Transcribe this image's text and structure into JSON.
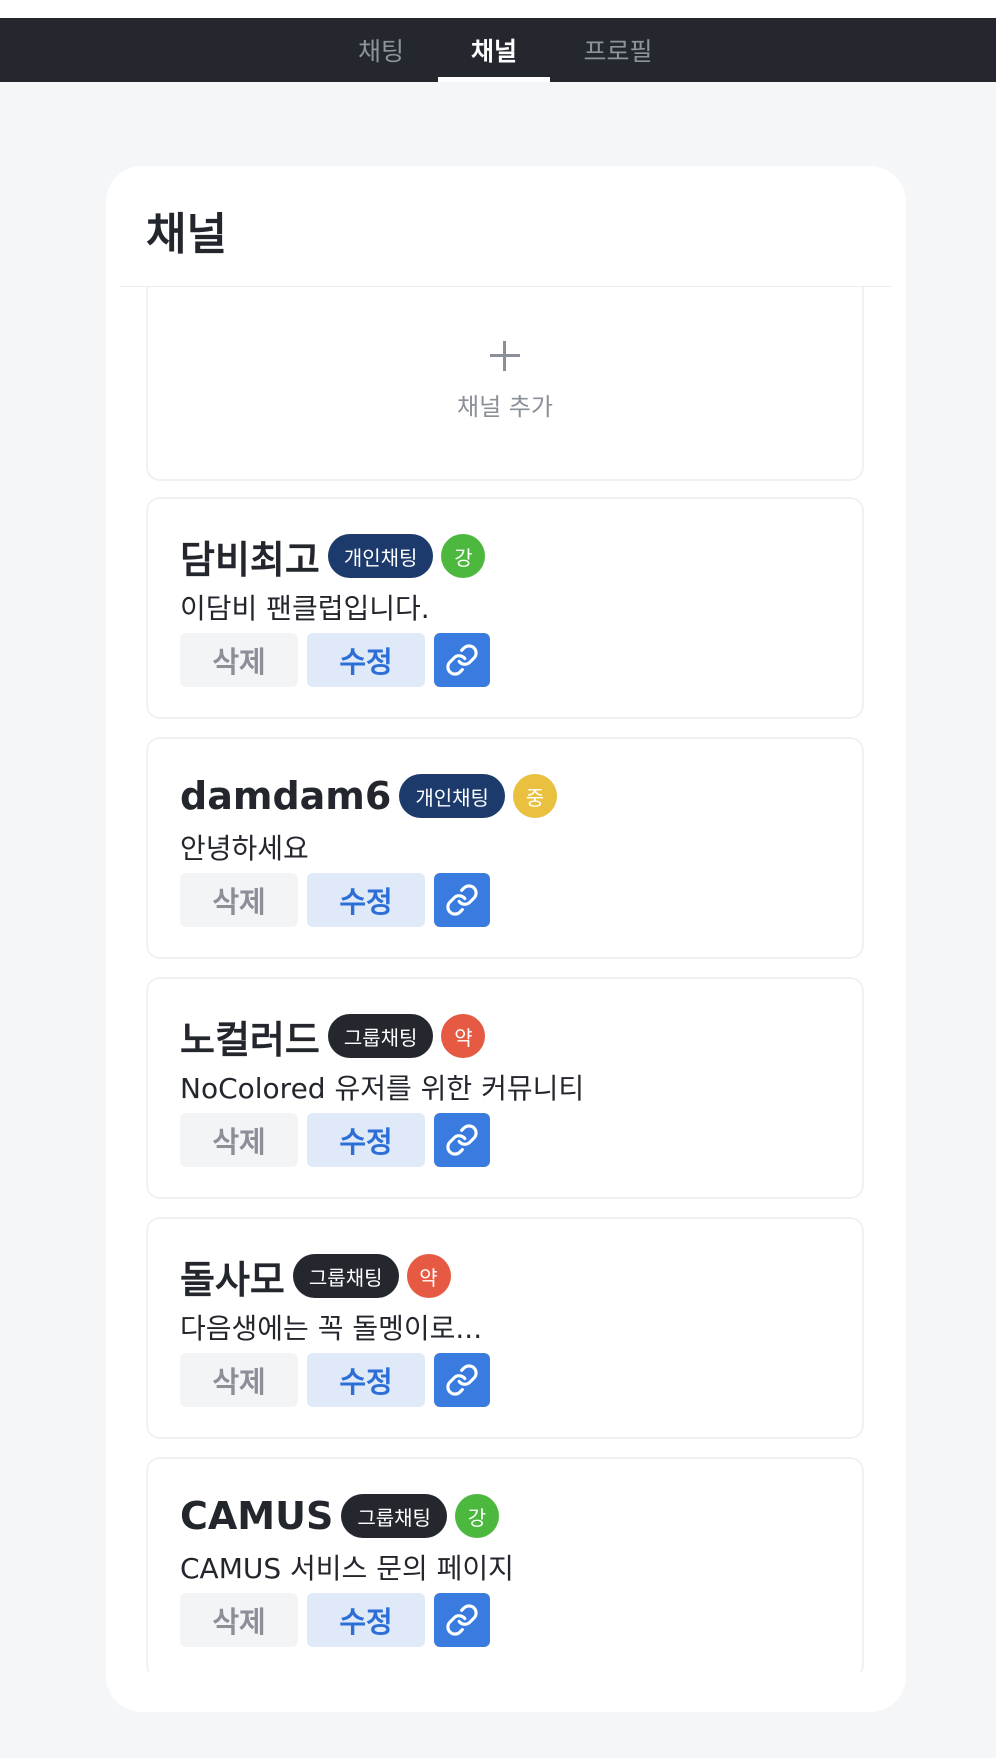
{
  "nav": {
    "tabs": [
      {
        "label": "채팅",
        "active": false
      },
      {
        "label": "채널",
        "active": true
      },
      {
        "label": "프로필",
        "active": false
      }
    ]
  },
  "page": {
    "title": "채널",
    "add_label": "채널 추가"
  },
  "channels": [
    {
      "name": "담비최고",
      "type": "개인채팅",
      "level": "강",
      "description": "이담비 팬클럽입니다.",
      "delete_label": "삭제",
      "edit_label": "수정"
    },
    {
      "name": "damdam6",
      "type": "개인채팅",
      "level": "중",
      "description": "안녕하세요",
      "delete_label": "삭제",
      "edit_label": "수정"
    },
    {
      "name": "노컬러드",
      "type": "그룹채팅",
      "level": "약",
      "description": "NoColored 유저를 위한 커뮤니티",
      "delete_label": "삭제",
      "edit_label": "수정"
    },
    {
      "name": "돌사모",
      "type": "그룹채팅",
      "level": "약",
      "description": "다음생에는 꼭 돌멩이로...",
      "delete_label": "삭제",
      "edit_label": "수정"
    },
    {
      "name": "CAMUS",
      "type": "그룹채팅",
      "level": "강",
      "description": "CAMUS 서비스 문의 페이지",
      "delete_label": "삭제",
      "edit_label": "수정"
    }
  ],
  "colors": {
    "nav_bg": "#24272e",
    "badge_personal": "#1c3a6b",
    "badge_group": "#24272e",
    "level_strong": "#4cb83d",
    "level_medium": "#e9c13e",
    "level_weak": "#e65a43",
    "edit_text": "#2d6fd6",
    "link_button": "#3a7be0"
  },
  "icons": {
    "add": "plus-icon",
    "share": "link-icon"
  }
}
